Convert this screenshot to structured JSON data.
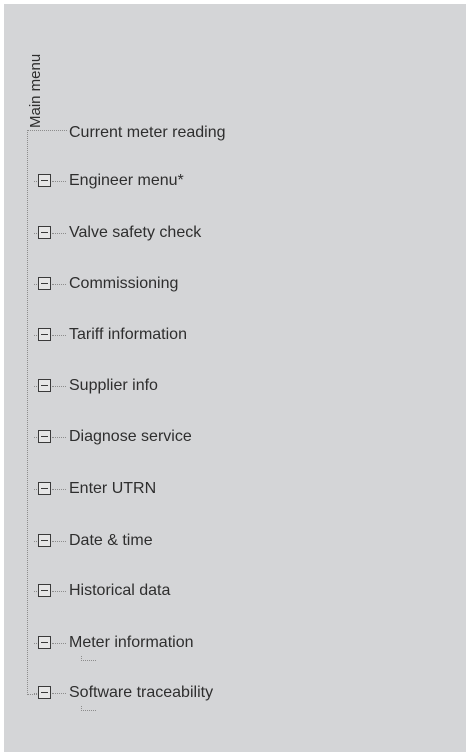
{
  "root_label": "Main menu",
  "first_item": "Current meter reading",
  "items": [
    {
      "label": "Engineer menu*"
    },
    {
      "label": "Valve safety check"
    },
    {
      "label": "Commissioning"
    },
    {
      "label": "Tariff information"
    },
    {
      "label": "Supplier info"
    },
    {
      "label": "Diagnose service"
    },
    {
      "label": "Enter UTRN"
    },
    {
      "label": "Date & time"
    },
    {
      "label": "Historical data"
    },
    {
      "label": "Meter information"
    },
    {
      "label": "Software traceability"
    }
  ],
  "colors": {
    "background": "#d4d5d7",
    "text": "#2e2e2e",
    "connector": "#8c8c8c",
    "box_border": "#3a3a3a"
  }
}
